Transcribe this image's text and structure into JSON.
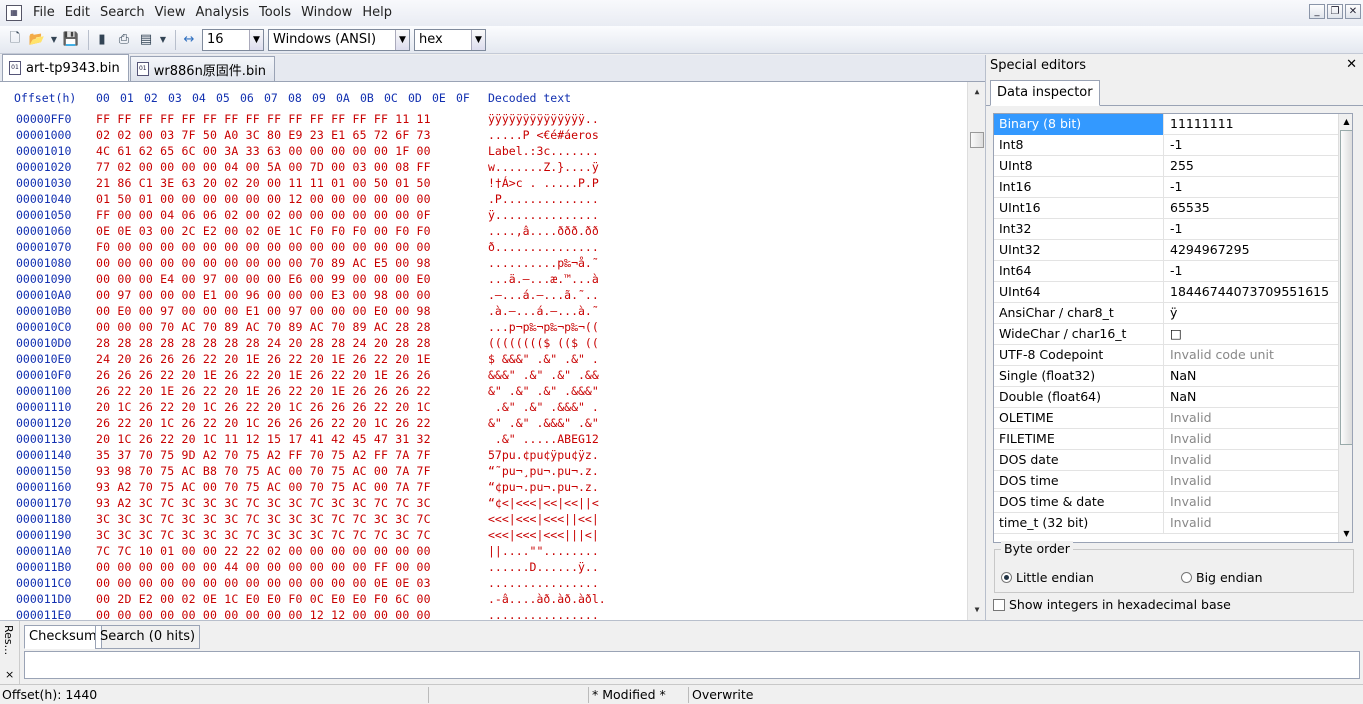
{
  "menu": [
    "File",
    "Edit",
    "Search",
    "View",
    "Analysis",
    "Tools",
    "Window",
    "Help"
  ],
  "toolbar": {
    "bytes_per_row": "16",
    "charset": "Windows (ANSI)",
    "display_mode": "hex"
  },
  "tabs": [
    {
      "label": "art-tp9343.bin",
      "active": true
    },
    {
      "label": "wr886n原固件.bin",
      "active": false
    }
  ],
  "hex": {
    "offset_header": "Offset(h)",
    "columns": [
      "00",
      "01",
      "02",
      "03",
      "04",
      "05",
      "06",
      "07",
      "08",
      "09",
      "0A",
      "0B",
      "0C",
      "0D",
      "0E",
      "0F"
    ],
    "decoded_header": "Decoded text",
    "rows": [
      {
        "offset": "00000FF0",
        "bytes": "FF FF FF FF FF FF FF FF FF FF FF FF FF FF 11 11",
        "text": "ÿÿÿÿÿÿÿÿÿÿÿÿÿÿ.."
      },
      {
        "offset": "00001000",
        "bytes": "02 02 00 03 7F 50 A0 3C 80 E9 23 E1 65 72 6F 73",
        "text": ".....P <€é#áeros"
      },
      {
        "offset": "00001010",
        "bytes": "4C 61 62 65 6C 00 3A 33 63 00 00 00 00 00 1F 00",
        "text": "Label.:3c......."
      },
      {
        "offset": "00001020",
        "bytes": "77 02 00 00 00 00 04 00 5A 00 7D 00 03 00 08 FF",
        "text": "w.......Z.}....ÿ"
      },
      {
        "offset": "00001030",
        "bytes": "21 86 C1 3E 63 20 02 20 00 11 11 01 00 50 01 50",
        "text": "!†Á>c . .....P.P"
      },
      {
        "offset": "00001040",
        "bytes": "01 50 01 00 00 00 00 00 00 12 00 00 00 00 00 00",
        "text": ".P.............."
      },
      {
        "offset": "00001050",
        "bytes": "FF 00 00 04 06 06 02 00 02 00 00 00 00 00 00 0F",
        "text": "ÿ..............."
      },
      {
        "offset": "00001060",
        "bytes": "0E 0E 03 00 2C E2 00 02 0E 1C F0 F0 F0 00 F0 F0",
        "text": "....,â....ððð.ðð"
      },
      {
        "offset": "00001070",
        "bytes": "F0 00 00 00 00 00 00 00 00 00 00 00 00 00 00 00",
        "text": "ð..............."
      },
      {
        "offset": "00001080",
        "bytes": "00 00 00 00 00 00 00 00 00 00 70 89 AC E5 00 98",
        "text": "..........p‰¬å.˜"
      },
      {
        "offset": "00001090",
        "bytes": "00 00 00 E4 00 97 00 00 00 E6 00 99 00 00 00 E0",
        "text": "...ä.—...æ.™...à"
      },
      {
        "offset": "000010A0",
        "bytes": "00 97 00 00 00 E1 00 96 00 00 00 E3 00 98 00 00",
        "text": ".—...á.–...ã.˜.."
      },
      {
        "offset": "000010B0",
        "bytes": "00 E0 00 97 00 00 00 E1 00 97 00 00 00 E0 00 98",
        "text": ".à.—...á.—...à.˜"
      },
      {
        "offset": "000010C0",
        "bytes": "00 00 00 70 AC 70 89 AC 70 89 AC 70 89 AC 28 28",
        "text": "...p¬p‰¬p‰¬p‰¬(("
      },
      {
        "offset": "000010D0",
        "bytes": "28 28 28 28 28 28 28 28 24 20 28 28 24 20 28 28",
        "text": "(((((((($ (($ (("
      },
      {
        "offset": "000010E0",
        "bytes": "24 20 26 26 26 22 20 1E 26 22 20 1E 26 22 20 1E",
        "text": "$ &&&\" .&\" .&\" ."
      },
      {
        "offset": "000010F0",
        "bytes": "26 26 26 22 20 1E 26 22 20 1E 26 22 20 1E 26 26",
        "text": "&&&\" .&\" .&\" .&&"
      },
      {
        "offset": "00001100",
        "bytes": "26 22 20 1E 26 22 20 1E 26 22 20 1E 26 26 26 22",
        "text": "&\" .&\" .&\" .&&&\""
      },
      {
        "offset": "00001110",
        "bytes": "20 1C 26 22 20 1C 26 22 20 1C 26 26 26 22 20 1C",
        "text": " .&\" .&\" .&&&\" ."
      },
      {
        "offset": "00001120",
        "bytes": "26 22 20 1C 26 22 20 1C 26 26 26 22 20 1C 26 22",
        "text": "&\" .&\" .&&&\" .&\""
      },
      {
        "offset": "00001130",
        "bytes": "20 1C 26 22 20 1C 11 12 15 17 41 42 45 47 31 32",
        "text": " .&\" .....ABEG12"
      },
      {
        "offset": "00001140",
        "bytes": "35 37 70 75 9D A2 70 75 A2 FF 70 75 A2 FF 7A 7F",
        "text": "57pu.¢pu¢ÿpu¢ÿz."
      },
      {
        "offset": "00001150",
        "bytes": "93 98 70 75 AC B8 70 75 AC 00 70 75 AC 00 7A 7F",
        "text": "“˜pu¬¸pu¬.pu¬.z."
      },
      {
        "offset": "00001160",
        "bytes": "93 A2 70 75 AC 00 70 75 AC 00 70 75 AC 00 7A 7F",
        "text": "“¢pu¬.pu¬.pu¬.z."
      },
      {
        "offset": "00001170",
        "bytes": "93 A2 3C 7C 3C 3C 3C 7C 3C 3C 7C 3C 3C 7C 7C 3C",
        "text": "“¢<|<<<|<<|<<||<"
      },
      {
        "offset": "00001180",
        "bytes": "3C 3C 3C 7C 3C 3C 3C 7C 3C 3C 3C 7C 7C 3C 3C 7C",
        "text": "<<<|<<<|<<<||<<|"
      },
      {
        "offset": "00001190",
        "bytes": "3C 3C 3C 7C 3C 3C 3C 7C 3C 3C 3C 7C 7C 7C 3C 7C",
        "text": "<<<|<<<|<<<|||<|"
      },
      {
        "offset": "000011A0",
        "bytes": "7C 7C 10 01 00 00 22 22 02 00 00 00 00 00 00 00",
        "text": "||....\"\"........"
      },
      {
        "offset": "000011B0",
        "bytes": "00 00 00 00 00 00 44 00 00 00 00 00 00 FF 00 00",
        "text": "......D......ÿ.."
      },
      {
        "offset": "000011C0",
        "bytes": "00 00 00 00 00 00 00 00 00 00 00 00 00 0E 0E 03",
        "text": "................"
      },
      {
        "offset": "000011D0",
        "bytes": "00 2D E2 00 02 0E 1C E0 E0 F0 0C E0 E0 F0 6C 00",
        "text": ".-â....àð.àð.àðl."
      },
      {
        "offset": "000011E0",
        "bytes": "00 00 00 00 00 00 00 00 00 00 12 12 00 00 00 00",
        "text": "................"
      }
    ]
  },
  "special_editors": {
    "title": "Special editors",
    "tab": "Data inspector",
    "rows": [
      {
        "key": "Binary (8 bit)",
        "value": "11111111",
        "dim": false
      },
      {
        "key": "Int8",
        "value": "-1",
        "dim": false
      },
      {
        "key": "UInt8",
        "value": "255",
        "dim": false
      },
      {
        "key": "Int16",
        "value": "-1",
        "dim": false
      },
      {
        "key": "UInt16",
        "value": "65535",
        "dim": false
      },
      {
        "key": "Int32",
        "value": "-1",
        "dim": false
      },
      {
        "key": "UInt32",
        "value": "4294967295",
        "dim": false
      },
      {
        "key": "Int64",
        "value": "-1",
        "dim": false
      },
      {
        "key": "UInt64",
        "value": "18446744073709551615",
        "dim": false
      },
      {
        "key": "AnsiChar / char8_t",
        "value": "ÿ",
        "dim": false
      },
      {
        "key": "WideChar / char16_t",
        "value": "□",
        "dim": false
      },
      {
        "key": "UTF-8 Codepoint",
        "value": "Invalid code unit",
        "dim": true
      },
      {
        "key": "Single (float32)",
        "value": "NaN",
        "dim": false
      },
      {
        "key": "Double (float64)",
        "value": "NaN",
        "dim": false
      },
      {
        "key": "OLETIME",
        "value": "Invalid",
        "dim": true
      },
      {
        "key": "FILETIME",
        "value": "Invalid",
        "dim": true
      },
      {
        "key": "DOS date",
        "value": "Invalid",
        "dim": true
      },
      {
        "key": "DOS time",
        "value": "Invalid",
        "dim": true
      },
      {
        "key": "DOS time & date",
        "value": "Invalid",
        "dim": true
      },
      {
        "key": "time_t (32 bit)",
        "value": "Invalid",
        "dim": true
      }
    ],
    "byte_order_label": "Byte order",
    "little_endian": "Little endian",
    "big_endian": "Big endian",
    "hex_checkbox": "Show integers in hexadecimal base"
  },
  "bottom": {
    "side_label": "Res...",
    "side_close": "×",
    "tabs": [
      "Checksum",
      "Search (0 hits)"
    ]
  },
  "status": {
    "offset": "Offset(h): 1440",
    "modified": "* Modified *",
    "mode": "Overwrite"
  }
}
